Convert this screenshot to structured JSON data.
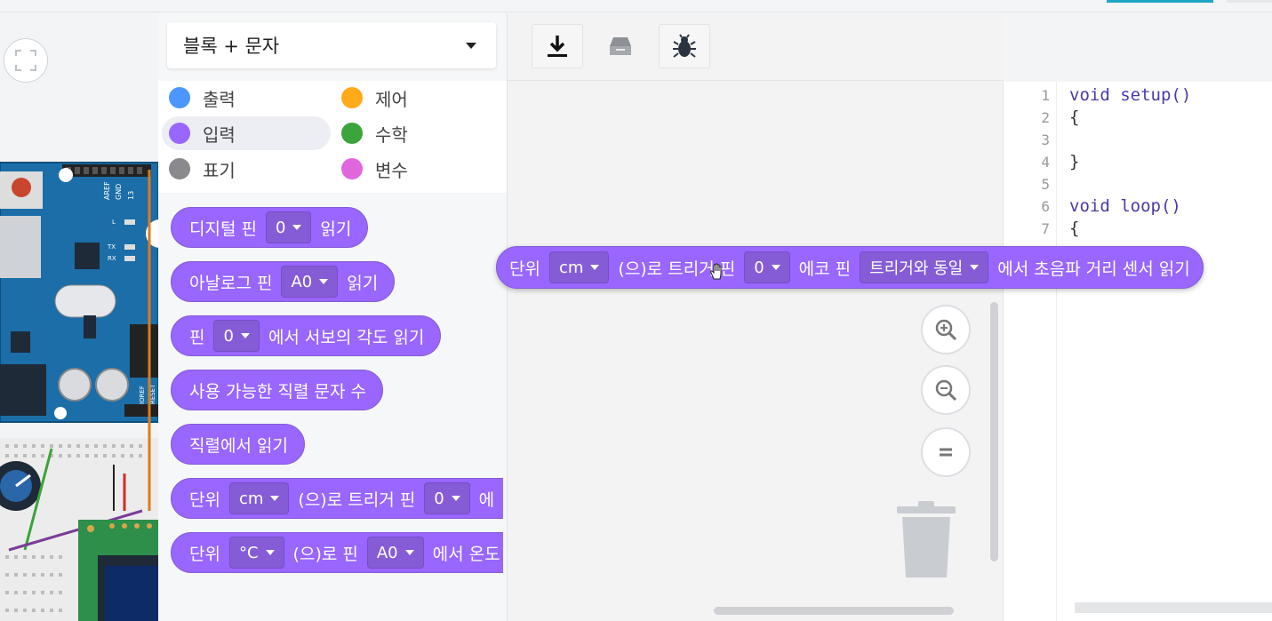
{
  "mode_select": {
    "label": "블록 + 문자"
  },
  "categories": [
    {
      "label": "출력",
      "color": "#4c97ff"
    },
    {
      "label": "제어",
      "color": "#ffab19"
    },
    {
      "label": "입력",
      "color": "#9966ff"
    },
    {
      "label": "수학",
      "color": "#3ca43c"
    },
    {
      "label": "표기",
      "color": "#8a8a8e"
    },
    {
      "label": "변수",
      "color": "#e066dd"
    }
  ],
  "blocks": {
    "digital_read": {
      "pre": "디지털 핀",
      "pin": "0",
      "post": "읽기"
    },
    "analog_read": {
      "pre": "아날로그 핀",
      "pin": "A0",
      "post": "읽기"
    },
    "servo_read": {
      "pre": "핀",
      "pin": "0",
      "post": "에서 서보의 각도 읽기"
    },
    "serial_available": {
      "text": "사용 가능한 직렬 문자 수"
    },
    "serial_read": {
      "text": "직렬에서 읽기"
    },
    "ultrasonic": {
      "pre": "단위",
      "unit": "cm",
      "mid": "(으)로 트리거 핀",
      "pin": "0",
      "tail": "에"
    },
    "temperature": {
      "pre": "단위",
      "unit": "°C",
      "mid": "(으)로 핀",
      "pin": "A0",
      "tail": "에서 온도"
    }
  },
  "dragged_block": {
    "pre": "단위",
    "unit": "cm",
    "mid": "(으)로 트리거 핀",
    "trigger_pin": "0",
    "echo_label": "에코 핀",
    "echo_value": "트리거와 동일",
    "post": "에서 초음파 거리 센서 읽기"
  },
  "toolbar": {
    "icons": [
      "download-icon",
      "upload-icon",
      "debug-bug-icon"
    ]
  },
  "code": {
    "lines": [
      {
        "n": "1",
        "text": "void setup()"
      },
      {
        "n": "2",
        "text": "{"
      },
      {
        "n": "3",
        "text": ""
      },
      {
        "n": "4",
        "text": "}"
      },
      {
        "n": "5",
        "text": ""
      },
      {
        "n": "6",
        "text": "void loop()"
      },
      {
        "n": "7",
        "text": "{"
      }
    ]
  }
}
